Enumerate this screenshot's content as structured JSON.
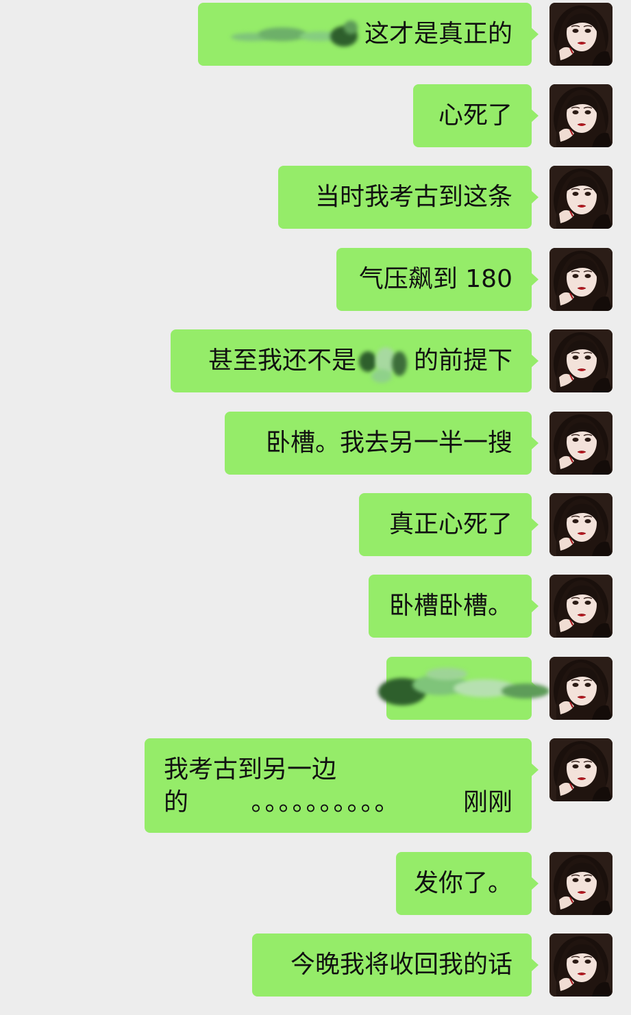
{
  "colors": {
    "background": "#ededed",
    "bubble": "#95ec69",
    "text": "#111111"
  },
  "messages": [
    {
      "id": "m1",
      "text": "这才是真正的",
      "redacted_prefix": true
    },
    {
      "id": "m2",
      "text": "心死了"
    },
    {
      "id": "m3",
      "text": "当时我考古到这条"
    },
    {
      "id": "m4",
      "text": "气压飙到 180"
    },
    {
      "id": "m5",
      "text_before": "甚至我还不是",
      "text_after": "的前提下",
      "redacted_middle": true
    },
    {
      "id": "m6",
      "text": "卧槽。我去另一半一搜"
    },
    {
      "id": "m7",
      "text": "真正心死了"
    },
    {
      "id": "m8",
      "text": "卧槽卧槽。"
    },
    {
      "id": "m9",
      "text": "",
      "redacted_full": true
    },
    {
      "id": "m10",
      "line1": "我考古到另一边",
      "line2_start": "的",
      "line2_dots": "。。。。。。。。。。",
      "line2_end": "刚刚"
    },
    {
      "id": "m11",
      "text": "发你了。"
    },
    {
      "id": "m12",
      "text": "今晚我将收回我的话"
    }
  ],
  "avatar": {
    "icon": "user-avatar-portrait"
  }
}
